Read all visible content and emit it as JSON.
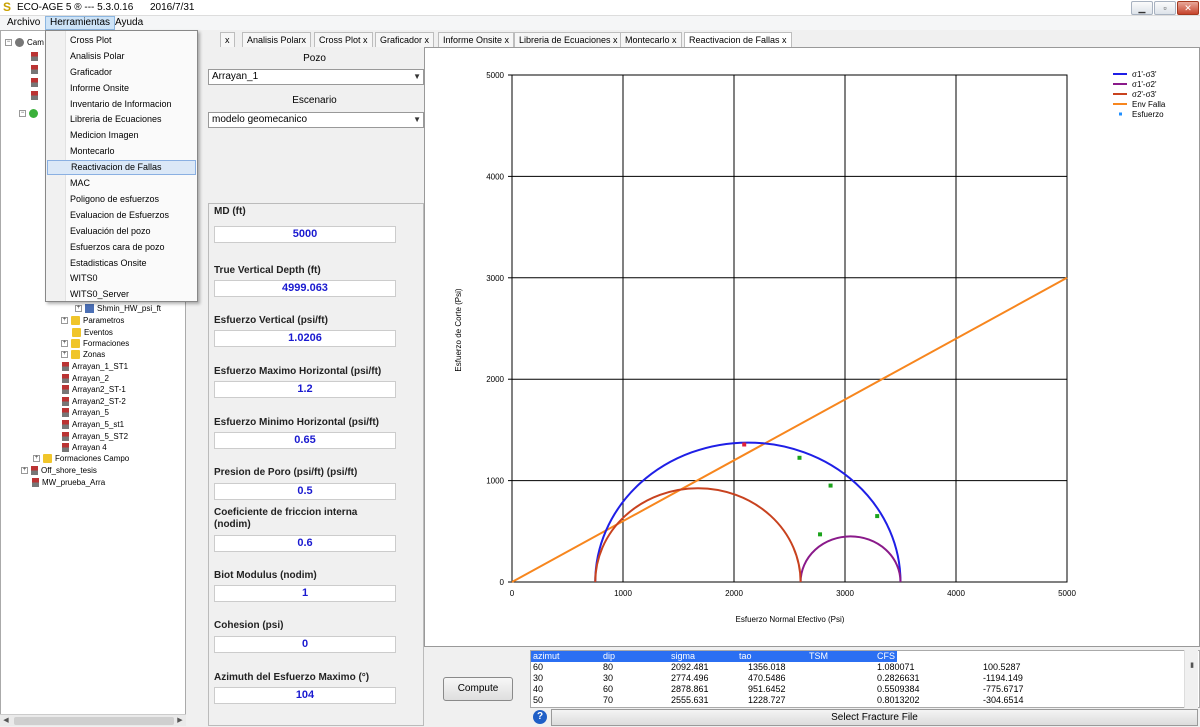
{
  "window": {
    "title": "ECO-AGE 5 ® --- 5.3.0.16      2016/7/31",
    "minimize": "▁",
    "maximize": "▫",
    "close": "✕"
  },
  "menubar": {
    "archivo": "Archivo",
    "herramientas": "Herramientas",
    "ayuda": "Ayuda"
  },
  "dropdown": {
    "items": [
      "Cross Plot",
      "Analisis Polar",
      "Graficador",
      "Informe Onsite",
      "Inventario de Informacion",
      "Libreria de Ecuaciones",
      "Medicion Imagen",
      "Montecarlo",
      "Reactivacion de Fallas",
      "MAC",
      "Poligono de esfuerzos",
      "Evaluacion de Esfuerzos",
      "Evaluación del pozo",
      "Esfuerzos cara de pozo",
      "Estadisticas Onsite",
      "WITS0",
      "WITS0_Server"
    ],
    "active_index": 8
  },
  "tree": {
    "root_label": "Cam",
    "nodes": [
      "Shmin_HW_psi_ft",
      "Parametros",
      "Eventos",
      "Formaciones",
      "Zonas",
      "Arrayan_1_ST1",
      "Arrayan_2",
      "Arrayan2_ST-1",
      "Arrayan2_ST-2",
      "Arrayan_5",
      "Arrayan_5_st1",
      "Arrayan_5_ST2",
      "Arrayan 4",
      "Formaciones Campo",
      "Off_shore_tesis",
      "MW_prueba_Arra"
    ]
  },
  "tabs": [
    "x",
    "Analisis Polarx",
    "Cross Plot x",
    "Graficador x",
    "Informe Onsite x",
    "Libreria de Ecuaciones x",
    "Montecarlo  x",
    "Reactivacion de Fallas    x"
  ],
  "form": {
    "pozo_label": "Pozo",
    "pozo_value": "Arrayan_1",
    "escenario_label": "Escenario",
    "escenario_value": "modelo geomecanico",
    "params": [
      {
        "label": "MD (ft)",
        "value": "5000"
      },
      {
        "label": "True Vertical Depth (ft)",
        "value": "4999.063"
      },
      {
        "label": "Esfuerzo Vertical (psi/ft)",
        "value": "1.0206"
      },
      {
        "label": "Esfuerzo Maximo Horizontal (psi/ft)",
        "value": "1.2"
      },
      {
        "label": "Esfuerzo Minimo Horizontal (psi/ft)",
        "value": "0.65"
      },
      {
        "label": "Presion de Poro (psi/ft) (psi/ft)",
        "value": "0.5"
      },
      {
        "label": "Coeficiente de friccion interna (nodim)",
        "value": "0.6"
      },
      {
        "label": "Biot Modulus (nodim)",
        "value": "1"
      },
      {
        "label": "Cohesion (psi)",
        "value": "0"
      },
      {
        "label": "Azimuth del Esfuerzo Maximo (°)",
        "value": "104"
      }
    ]
  },
  "chart_data": {
    "type": "line",
    "xlabel": "Esfuerzo Normal Efectivo (Psi)",
    "ylabel": "Esfuerzo de Corte (Psi)",
    "xlim": [
      0,
      5000
    ],
    "ylim": [
      0,
      5000
    ],
    "xticks": [
      "0",
      "1000",
      "2000",
      "3000",
      "4000",
      "5000"
    ],
    "yticks": [
      "0",
      "1000",
      "2000",
      "3000",
      "4000",
      "5000"
    ],
    "grid": true,
    "legend_position": "top-right",
    "mohr_circles": [
      {
        "name": "σ1'-σ3'",
        "color": "#1f1fe6",
        "s_min": 750,
        "s_max": 3500
      },
      {
        "name": "σ1'-σ2'",
        "color": "#8a1a8a",
        "s_min": 2600,
        "s_max": 3500
      },
      {
        "name": "σ2'-σ3'",
        "color": "#c8421f",
        "s_min": 750,
        "s_max": 2600
      }
    ],
    "failure_envelope": {
      "name": "Env Falla",
      "color": "#f7861e",
      "cohesion": 0,
      "friction": 0.6,
      "x": [
        0,
        5000
      ],
      "y": [
        0,
        3000
      ]
    },
    "points": {
      "name": "Esfuerzo",
      "color": "#1ba31b",
      "x": [
        2092,
        2590,
        2870,
        2775,
        3290
      ],
      "y": [
        1356,
        1225,
        951,
        470,
        650
      ],
      "highlight_color": "#e0203a"
    }
  },
  "bottom": {
    "compute_label": "Compute",
    "select_file_label": "Select Fracture File",
    "help_glyph": "?",
    "table": {
      "columns": [
        "azimut",
        "dip",
        "sigma",
        "tao",
        "TSM",
        "CFS"
      ],
      "rows": [
        [
          "60",
          "80",
          "2092.481",
          "1356.018",
          "1.080071",
          "100.5287"
        ],
        [
          "30",
          "30",
          "2774.496",
          "470.5486",
          "0.2826631",
          "-1194.149"
        ],
        [
          "40",
          "60",
          "2878.861",
          "951.6452",
          "0.5509384",
          "-775.6717"
        ],
        [
          "50",
          "70",
          "2555.631",
          "1228.727",
          "0.8013202",
          "-304.6514"
        ]
      ]
    }
  }
}
